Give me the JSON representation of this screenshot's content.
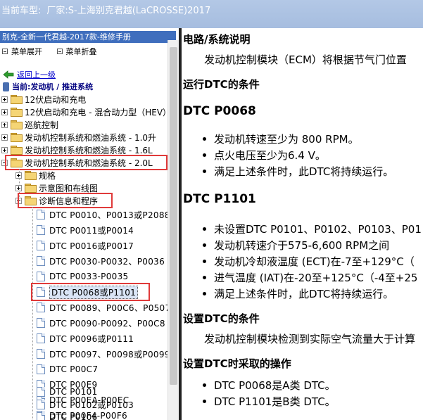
{
  "titlebar": {
    "label": "当前车型:",
    "value": "厂家:S-上海别克君越(LaCROSSE)2017"
  },
  "sidebar": {
    "header": "别克-全新一代君越-2017款-维修手册",
    "toolbar": {
      "expand": "菜单展开",
      "collapse": "菜单折叠"
    },
    "back_link": "返回上一级",
    "current": "当前:发动机 / 推进系统",
    "tree": [
      {
        "label": "12伏启动和充电"
      },
      {
        "label": "12伏启动和充电 - 混合动力型（HEV）"
      },
      {
        "label": "巡航控制"
      },
      {
        "label": "发动机控制系统和燃油系统 - 1.0升"
      },
      {
        "label": "发动机控制系统和燃油系统 - 1.6L"
      },
      {
        "label": "发动机控制系统和燃油系统 - 2.0L"
      },
      {
        "label": "规格"
      },
      {
        "label": "示意图和布线图"
      },
      {
        "label": "诊断信息和程序"
      }
    ],
    "docs": [
      "DTC P0010、P0013或P2088",
      "DTC P0011或P0014",
      "DTC P0016或P0017",
      "DTC P0030-P0032、P0036",
      "DTC P0033-P0035",
      "DTC P0068或P1101",
      "DTC P0089、P00C6、P0507",
      "DTC P0090-P0092、P00C8",
      "DTC P0096或P0111",
      "DTC P0097、P0098或P0099",
      "DTC P00C7",
      "DTC P00E9",
      "DTC P00EA-P00EC",
      "DTC P00F4-P00F6",
      "DTC P0101",
      "DTC P0102或P0103",
      "DTC P0106"
    ]
  },
  "content": {
    "sec1_title": "电路/系统说明",
    "sec1_para": "发动机控制模块（ECM）将根据节气门位置",
    "sec2_title": "运行DTC的条件",
    "dtc1_title": "DTC P0068",
    "dtc1_bullets": [
      "发动机转速至少为 800 RPM。",
      "点火电压至少为6.4 V。",
      "满足上述条件时，此DTC将持续运行。"
    ],
    "dtc2_title": "DTC P1101",
    "dtc2_bullets": [
      "未设置DTC P0101、P0102、P0103、P01",
      "发动机转速介于575-6,600 RPM之间",
      "发动机冷却液温度 (ECT)在-7至+129°C（",
      "进气温度 (IAT)在-20至+125°C（-4至+25",
      "满足上述条件时，此DTC将持续运行。"
    ],
    "sec3_title": "设置DTC的条件",
    "sec3_para": "发动机控制模块检测到实际空气流量大于计算",
    "sec4_title": "设置DTC时采取的操作",
    "sec4_bullets": [
      "DTC P0068是A类 DTC。",
      "DTC P1101是B类 DTC。"
    ]
  }
}
